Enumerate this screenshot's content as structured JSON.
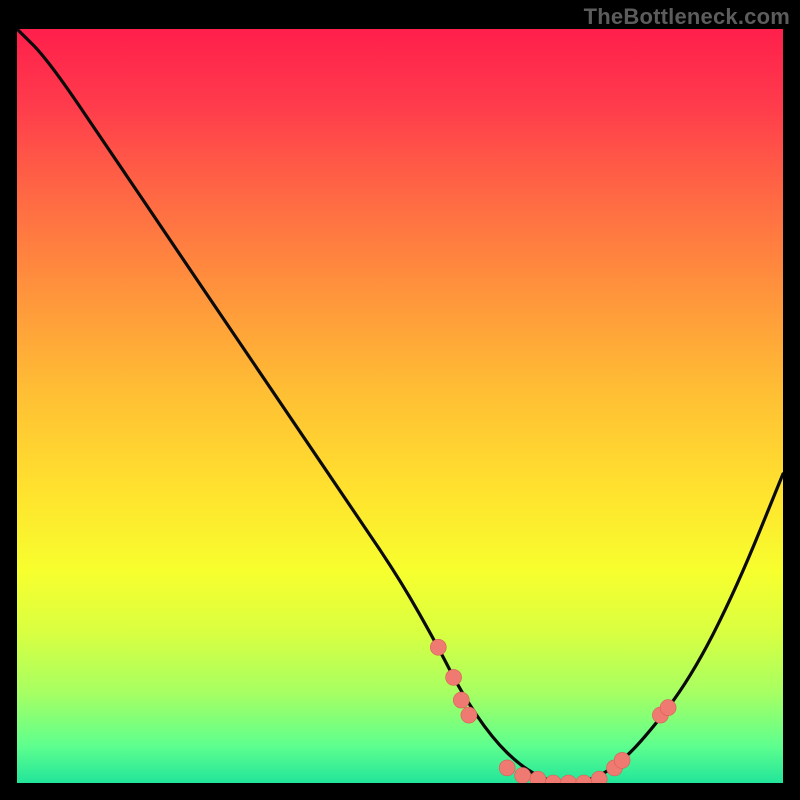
{
  "watermark": "TheBottleneck.com",
  "colors": {
    "background": "#000000",
    "gradient_top": "#ff1f4b",
    "gradient_mid": "#ffe42e",
    "gradient_bottom": "#22e59a",
    "curve": "#0b0b0b",
    "dot_fill": "#ee7a71"
  },
  "chart_data": {
    "type": "line",
    "title": "",
    "xlabel": "",
    "ylabel": "",
    "xlim": [
      0,
      100
    ],
    "ylim": [
      0,
      100
    ],
    "series": [
      {
        "name": "bottleneck-curve",
        "x": [
          0,
          4,
          12,
          20,
          28,
          36,
          44,
          50,
          55,
          58,
          62,
          66,
          70,
          74,
          78,
          82,
          88,
          94,
          100
        ],
        "values": [
          100,
          96,
          84,
          72,
          60,
          48,
          36,
          27,
          18,
          12,
          6,
          2,
          0,
          0,
          2,
          6,
          14,
          26,
          41
        ]
      }
    ],
    "markers": [
      {
        "x": 55,
        "y": 18
      },
      {
        "x": 57,
        "y": 14
      },
      {
        "x": 58,
        "y": 11
      },
      {
        "x": 59,
        "y": 9
      },
      {
        "x": 64,
        "y": 2
      },
      {
        "x": 66,
        "y": 1
      },
      {
        "x": 68,
        "y": 0.5
      },
      {
        "x": 70,
        "y": 0
      },
      {
        "x": 72,
        "y": 0
      },
      {
        "x": 74,
        "y": 0
      },
      {
        "x": 76,
        "y": 0.5
      },
      {
        "x": 78,
        "y": 2
      },
      {
        "x": 79,
        "y": 3
      },
      {
        "x": 84,
        "y": 9
      },
      {
        "x": 85,
        "y": 10
      }
    ],
    "annotations": []
  }
}
